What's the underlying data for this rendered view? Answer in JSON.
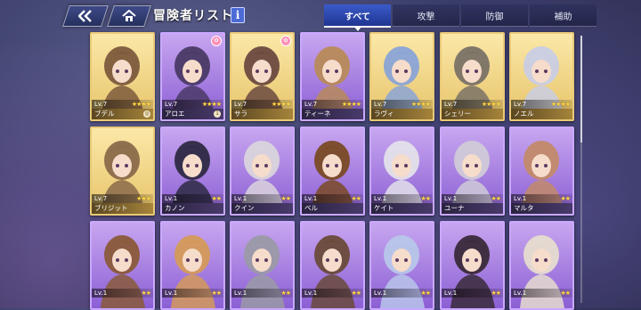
{
  "header": {
    "title": "冒険者リスト",
    "info_label": "i"
  },
  "tabs": [
    {
      "label": "すべて",
      "active": true
    },
    {
      "label": "攻撃",
      "active": false
    },
    {
      "label": "防御",
      "active": false
    },
    {
      "label": "補助",
      "active": false
    }
  ],
  "colors": {
    "accent": "#3b5bc9",
    "gold_frame": "#e9c978",
    "purple_frame": "#c9a8ff",
    "star": "#ffd84a"
  },
  "cards": [
    {
      "name": "ブデル",
      "level": "Lv.7",
      "stars": "★★★★",
      "rarity": "gold",
      "badge": "◎",
      "hue": "#7c5a3c"
    },
    {
      "name": "アロエ",
      "level": "Lv.7",
      "stars": "★★★★",
      "rarity": "purple",
      "badge": "1",
      "hue": "#4a3a66"
    },
    {
      "name": "サラ",
      "level": "Lv.7",
      "stars": "★★★★",
      "rarity": "gold",
      "badge": "",
      "hue": "#6b4a40"
    },
    {
      "name": "ティーネ",
      "level": "Lv.7",
      "stars": "★★★★",
      "rarity": "purple",
      "badge": "",
      "hue": "#b88a5a"
    },
    {
      "name": "ラヴィ",
      "level": "Lv.7",
      "stars": "★★★★",
      "rarity": "gold",
      "badge": "",
      "hue": "#8aa4d6"
    },
    {
      "name": "シェリー",
      "level": "Lv.7",
      "stars": "★★★★",
      "rarity": "gold",
      "badge": "",
      "hue": "#7a7266"
    },
    {
      "name": "ノエル",
      "level": "Lv.7",
      "stars": "★★★★",
      "rarity": "gold",
      "badge": "",
      "hue": "#c9cde4"
    },
    {
      "name": "ブリジット",
      "level": "Lv.7",
      "stars": "★★★",
      "rarity": "gold",
      "badge": "",
      "hue": "#8a6a4a"
    },
    {
      "name": "カノン",
      "level": "Lv.1",
      "stars": "★★",
      "rarity": "purple",
      "badge": "",
      "hue": "#2e2a44"
    },
    {
      "name": "クイン",
      "level": "Lv.1",
      "stars": "★★",
      "rarity": "purple",
      "badge": "",
      "hue": "#d9d4dc"
    },
    {
      "name": "ベル",
      "level": "Lv.1",
      "stars": "★★",
      "rarity": "purple",
      "badge": "",
      "hue": "#7a4a26"
    },
    {
      "name": "ケイト",
      "level": "Lv.1",
      "stars": "★★",
      "rarity": "purple",
      "badge": "",
      "hue": "#e3e0ea"
    },
    {
      "name": "ユーナ",
      "level": "Lv.1",
      "stars": "★★",
      "rarity": "purple",
      "badge": "",
      "hue": "#cfcad8"
    },
    {
      "name": "マルタ",
      "level": "Lv.1",
      "stars": "★★",
      "rarity": "purple",
      "badge": "",
      "hue": "#c28a6a"
    },
    {
      "name": "",
      "level": "Lv.1",
      "stars": "★★",
      "rarity": "purple",
      "badge": "",
      "hue": "#8a5a3a"
    },
    {
      "name": "",
      "level": "Lv.1",
      "stars": "★★",
      "rarity": "purple",
      "badge": "",
      "hue": "#d49a5a"
    },
    {
      "name": "",
      "level": "Lv.1",
      "stars": "★★",
      "rarity": "purple",
      "badge": "",
      "hue": "#9a9aa6"
    },
    {
      "name": "",
      "level": "Lv.1",
      "stars": "★★",
      "rarity": "purple",
      "badge": "",
      "hue": "#6a4a3a"
    },
    {
      "name": "",
      "level": "Lv.1",
      "stars": "★★",
      "rarity": "purple",
      "badge": "",
      "hue": "#b8c6ea"
    },
    {
      "name": "",
      "level": "Lv.1",
      "stars": "★★",
      "rarity": "purple",
      "badge": "",
      "hue": "#3a2a3a"
    },
    {
      "name": "",
      "level": "Lv.1",
      "stars": "★★",
      "rarity": "purple",
      "badge": "",
      "hue": "#e6dccf"
    }
  ]
}
